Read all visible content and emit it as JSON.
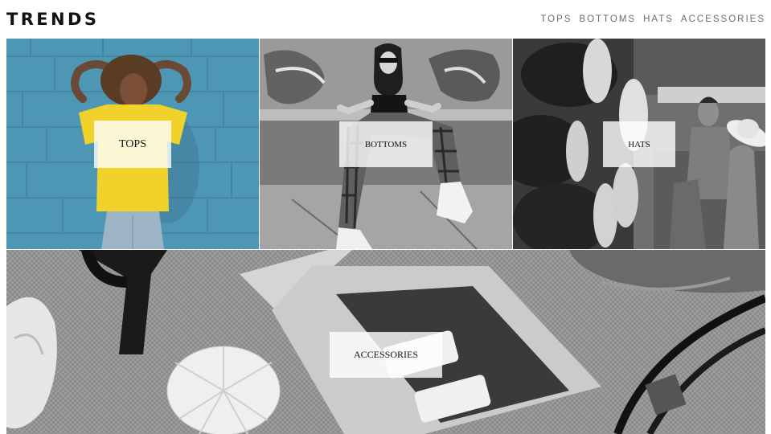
{
  "header": {
    "brand": "TRENDS",
    "nav": [
      {
        "label": "TOPS"
      },
      {
        "label": "BOTTOMS"
      },
      {
        "label": "HATS"
      },
      {
        "label": "ACCESSORIES"
      }
    ]
  },
  "tiles": [
    {
      "label": "TOPS",
      "photo": "woman-yellow-shirt-blue-brick-wall"
    },
    {
      "label": "BOTTOMS",
      "photo": "woman-plaid-pants-graffiti-wall-bw"
    },
    {
      "label": "HATS",
      "photo": "hat-shop-display-bw"
    },
    {
      "label": "ACCESSORIES",
      "photo": "lipgloss-sunglasses-flower-burlap-bw"
    }
  ],
  "colors": {
    "background": "#ffffff",
    "brand_text": "#111111",
    "nav_text": "#6b6b6b",
    "label_overlay": "rgba(255,255,255,0.80)",
    "tops_wall": "#4f9cba"
  }
}
